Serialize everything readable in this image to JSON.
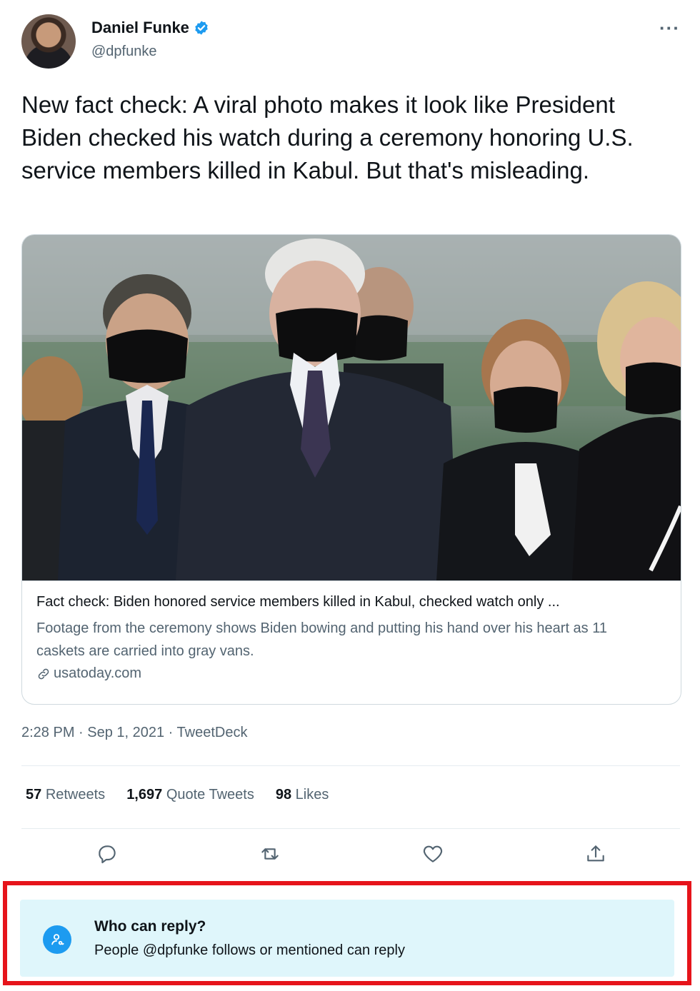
{
  "author": {
    "display_name": "Daniel Funke",
    "handle": "@dpfunke",
    "verified": true
  },
  "more_label": "···",
  "tweet_text": "New fact check: A viral photo makes it look like President Biden checked his watch during a ceremony honoring U.S. service members killed in Kabul. But that's misleading.",
  "card": {
    "title": "Fact check: Biden honored service members killed in Kabul, checked watch only ...",
    "description": "Footage from the ceremony shows Biden bowing and putting his hand over his heart as 11 caskets are carried into gray vans.",
    "domain": "usatoday.com"
  },
  "meta": {
    "timestamp": "2:28 PM · Sep 1, 2021 · TweetDeck"
  },
  "stats": {
    "retweets_count": "57",
    "retweets_label": "Retweets",
    "quotes_count": "1,697",
    "quotes_label": "Quote Tweets",
    "likes_count": "98",
    "likes_label": "Likes"
  },
  "actions": {
    "reply_icon": "reply-icon",
    "retweet_icon": "retweet-icon",
    "like_icon": "heart-icon",
    "share_icon": "share-icon"
  },
  "who_can_reply": {
    "title": "Who can reply?",
    "subtitle": "People @dpfunke follows or mentioned can reply"
  },
  "colors": {
    "accent": "#1d9bf0",
    "highlight_border": "#e6141b",
    "reply_banner_bg": "#dff6fb",
    "secondary_text": "#536471"
  }
}
